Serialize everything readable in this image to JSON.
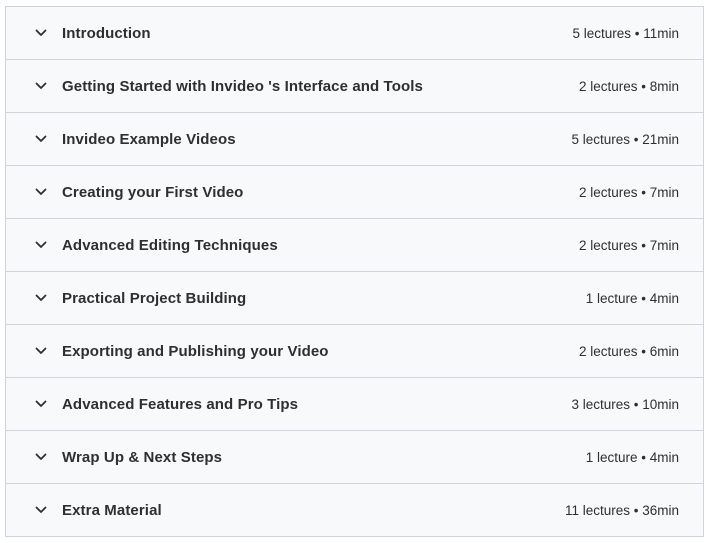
{
  "sections": [
    {
      "title": "Introduction",
      "meta": "5 lectures • 11min"
    },
    {
      "title": "Getting Started with Invideo 's Interface and Tools",
      "meta": "2 lectures • 8min"
    },
    {
      "title": "Invideo Example Videos",
      "meta": "5 lectures • 21min"
    },
    {
      "title": "Creating your First Video",
      "meta": "2 lectures • 7min"
    },
    {
      "title": "Advanced Editing Techniques",
      "meta": "2 lectures • 7min"
    },
    {
      "title": "Practical Project Building",
      "meta": "1 lecture • 4min"
    },
    {
      "title": "Exporting and Publishing your Video",
      "meta": "2 lectures • 6min"
    },
    {
      "title": "Advanced Features and Pro Tips",
      "meta": "3 lectures • 10min"
    },
    {
      "title": "Wrap Up & Next Steps",
      "meta": "1 lecture • 4min"
    },
    {
      "title": "Extra Material",
      "meta": "11 lectures • 36min"
    }
  ],
  "icons": {
    "expand": "chevron-down-icon"
  }
}
